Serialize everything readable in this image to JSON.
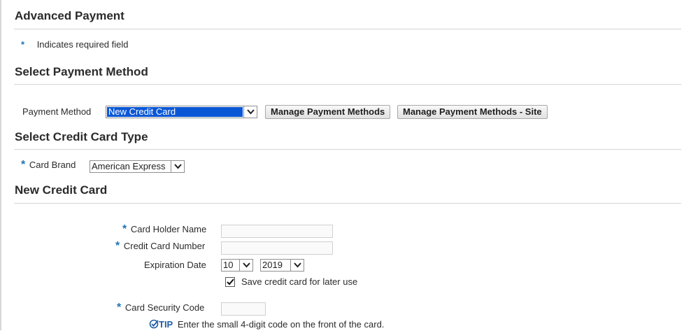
{
  "page": {
    "title": "Advanced Payment"
  },
  "required_note": {
    "marker": "*",
    "text": "Indicates required field"
  },
  "payment_method_section": {
    "title": "Select Payment Method",
    "label": "Payment Method",
    "selected": "New Credit Card",
    "buttons": [
      "Manage Payment Methods",
      "Manage Payment Methods - Site"
    ]
  },
  "card_type_section": {
    "title": "Select Credit Card Type",
    "card_brand_label": "Card Brand",
    "card_brand_value": "American Express"
  },
  "new_card_section": {
    "title": "New Credit Card",
    "card_holder_label": "Card Holder Name",
    "card_holder_value": "",
    "card_number_label": "Credit Card Number",
    "card_number_value": "",
    "expiration_label": "Expiration Date",
    "expiration_month": "10",
    "expiration_year": "2019",
    "save_card_label": "Save credit card for later use",
    "save_card_checked": true,
    "security_code_label": "Card Security Code",
    "security_code_value": "",
    "tip_label": "TIP",
    "tip_text": "Enter the small 4-digit code on the front of the card."
  },
  "colors": {
    "required_star": "#1f74b8",
    "selection_highlight": "#0a57d6",
    "tip_label": "#1f5fa8"
  },
  "icons": {
    "dropdown": "chevron-down-icon",
    "tip": "tip-check-icon",
    "checkbox": "checkmark-icon"
  }
}
